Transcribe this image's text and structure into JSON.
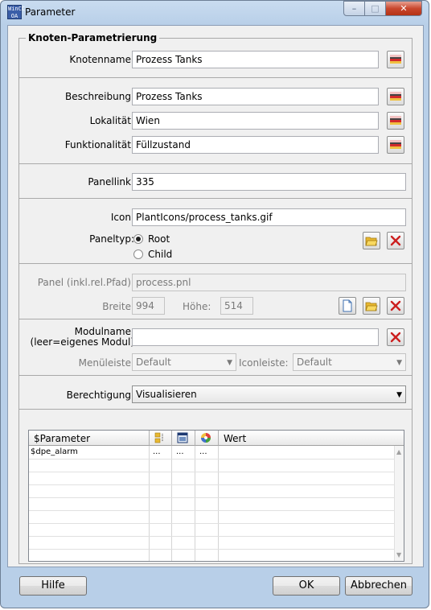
{
  "window": {
    "title": "Parameter",
    "icon_text": "WinCC OA",
    "minimize_glyph": "–",
    "maximize_glyph": "□",
    "close_glyph": "✕"
  },
  "group": {
    "title": "Knoten-Parametrierung"
  },
  "knotenname": {
    "label": "Knotenname:",
    "value": "Prozess Tanks"
  },
  "beschreibung": {
    "label": "Beschreibung:",
    "value": "Prozess Tanks"
  },
  "lokalitaet": {
    "label": "Lokalität:",
    "value": "Wien"
  },
  "funktionalitaet": {
    "label": "Funktionalität:",
    "value": "Füllzustand"
  },
  "panellink": {
    "label": "Panellink:",
    "value": "335"
  },
  "icon": {
    "label": "Icon:",
    "value": "PlantIcons/process_tanks.gif"
  },
  "paneltyp": {
    "label": "Paneltyp:",
    "options": [
      "Root",
      "Child"
    ],
    "selected": "Root"
  },
  "panel": {
    "label": "Panel (inkl.rel.Pfad):",
    "value": "process.pnl",
    "breite_label": "Breite:",
    "breite_value": "994",
    "hoehe_label": "Höhe:",
    "hoehe_value": "514"
  },
  "modul": {
    "label_line1": "Modulname:",
    "label_line2": "(leer=eigenes Modul)",
    "value": "",
    "menueleiste_label": "Menüleiste:",
    "menueleiste_value": "Default",
    "iconleiste_label": "Iconleiste:",
    "iconleiste_value": "Default"
  },
  "berechtigung": {
    "label": "Berechtigung:",
    "value": "Visualisieren"
  },
  "table": {
    "columns": [
      "$Parameter",
      "",
      "",
      "",
      "Wert"
    ],
    "rows": [
      {
        "parameter": "$dpe_alarm",
        "c1": "...",
        "c2": "...",
        "c3": "...",
        "wert": ""
      }
    ]
  },
  "buttons": {
    "help": "Hilfe",
    "ok": "OK",
    "cancel": "Abbrechen"
  },
  "colors": {
    "title_bar": "#b8cfe8",
    "dialog_bg": "#f0f0f0",
    "close_button": "#c9472e",
    "delete_icon": "#cc1f1f",
    "folder_icon": "#f0c040"
  }
}
